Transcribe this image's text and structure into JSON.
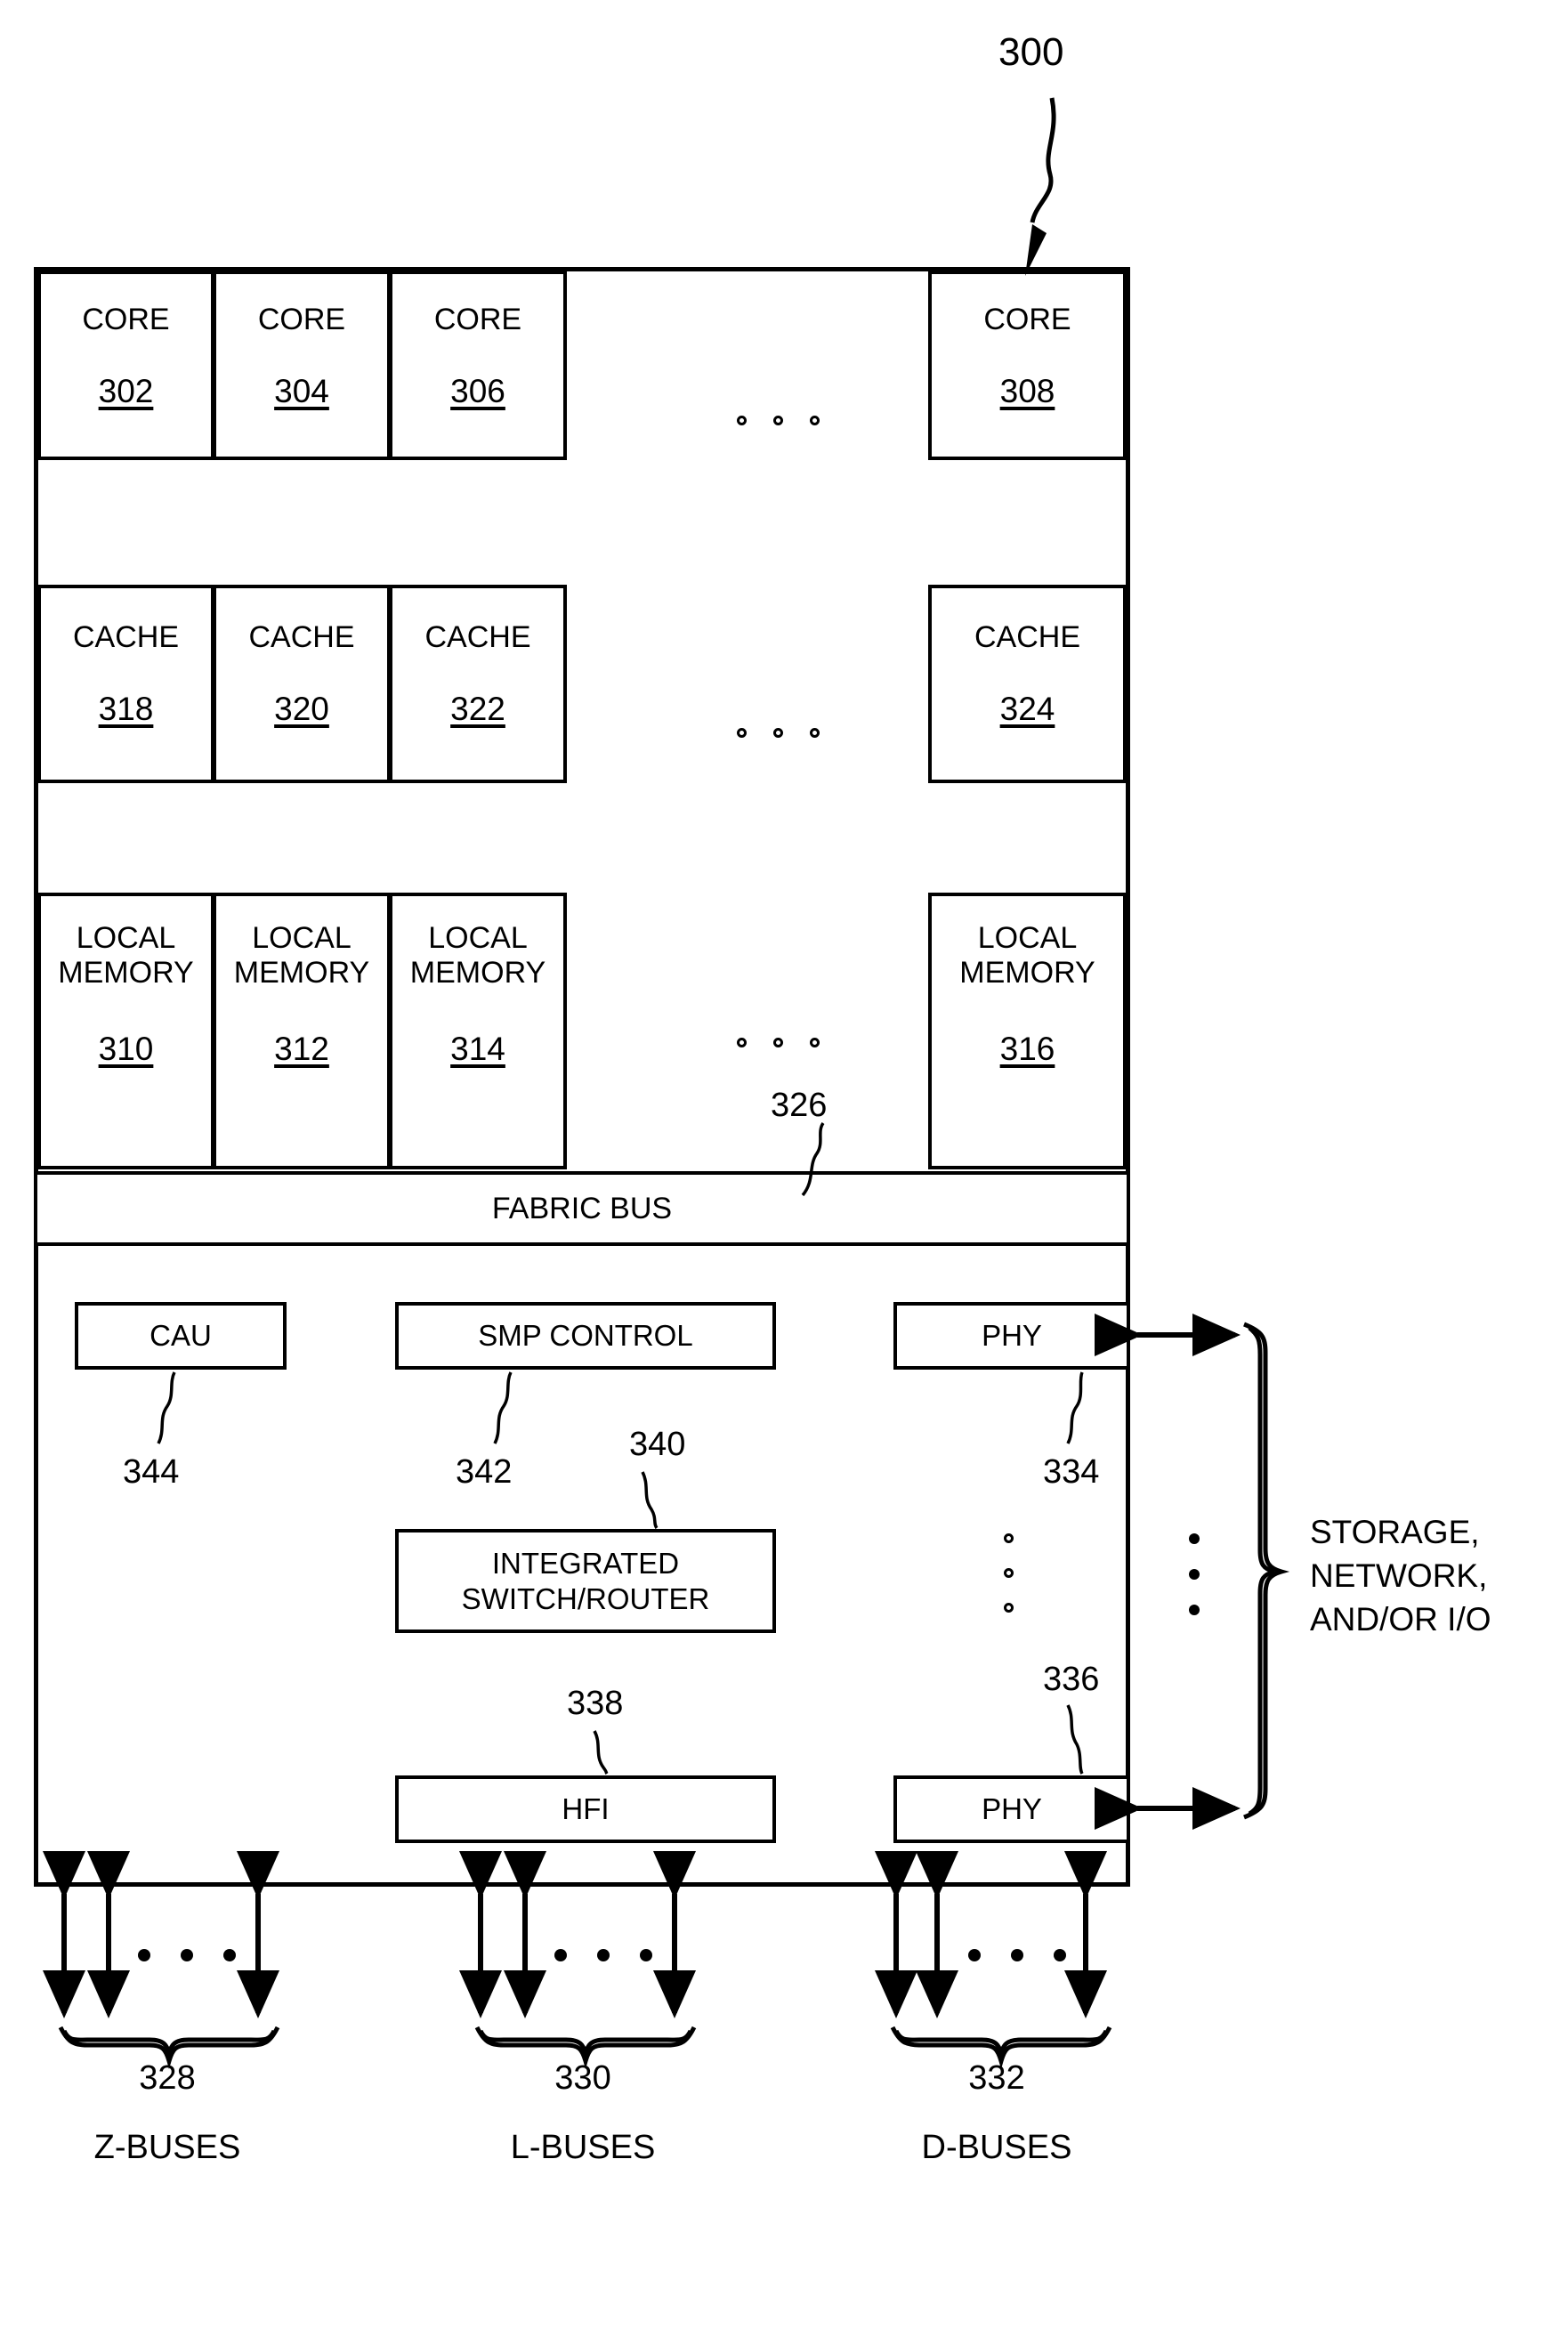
{
  "figure": {
    "reference_numeral": "300"
  },
  "chip": {
    "core_row": {
      "cells": [
        {
          "title": "CORE",
          "num": "302"
        },
        {
          "title": "CORE",
          "num": "304"
        },
        {
          "title": "CORE",
          "num": "306"
        },
        {
          "title": "CORE",
          "num": "308"
        }
      ],
      "ellipsis": "o o o"
    },
    "cache_row": {
      "cells": [
        {
          "title": "CACHE",
          "num": "318"
        },
        {
          "title": "CACHE",
          "num": "320"
        },
        {
          "title": "CACHE",
          "num": "322"
        },
        {
          "title": "CACHE",
          "num": "324"
        }
      ],
      "ellipsis": "o o o"
    },
    "local_memory_row": {
      "cells": [
        {
          "title": "LOCAL\nMEMORY",
          "num": "310"
        },
        {
          "title": "LOCAL\nMEMORY",
          "num": "312"
        },
        {
          "title": "LOCAL\nMEMORY",
          "num": "314"
        },
        {
          "title": "LOCAL\nMEMORY",
          "num": "316"
        }
      ],
      "ellipsis": "o o o",
      "gap_numeral": "326"
    },
    "fabric_bus": {
      "label": "FABRIC BUS"
    },
    "lower": {
      "cau": {
        "label": "CAU",
        "numeral": "344"
      },
      "smp_control": {
        "label": "SMP CONTROL",
        "numeral": "342"
      },
      "integrated_switch_router": {
        "label": "INTEGRATED\nSWITCH/ROUTER",
        "numeral": "340"
      },
      "hfi": {
        "label": "HFI",
        "numeral": "338"
      },
      "phy_top": {
        "label": "PHY",
        "numeral": "334"
      },
      "phy_bottom": {
        "label": "PHY",
        "numeral": "336"
      }
    }
  },
  "external": {
    "brace_label": "STORAGE,\nNETWORK,\nAND/OR I/O"
  },
  "buses": [
    {
      "numeral": "328",
      "label": "Z-BUSES"
    },
    {
      "numeral": "330",
      "label": "L-BUSES"
    },
    {
      "numeral": "332",
      "label": "D-BUSES"
    }
  ]
}
